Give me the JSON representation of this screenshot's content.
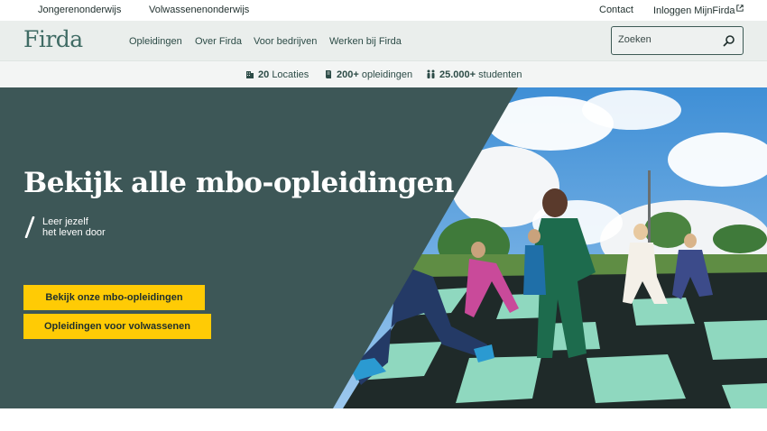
{
  "topbar": {
    "left_links": [
      "Jongerenonderwijs",
      "Volwassenenonderwijs"
    ],
    "contact": "Contact",
    "login": "Inloggen MijnFirda"
  },
  "nav": {
    "logo": "Firda",
    "links": [
      "Opleidingen",
      "Over Firda",
      "Voor bedrijven",
      "Werken bij Firda"
    ],
    "search_placeholder": "Zoeken"
  },
  "stats": [
    {
      "value": "20",
      "label": "Locaties",
      "icon": "building-icon"
    },
    {
      "value": "200+",
      "label": "opleidingen",
      "icon": "book-icon"
    },
    {
      "value": "25.000+",
      "label": "studenten",
      "icon": "people-icon"
    }
  ],
  "hero": {
    "title": "Bekijk alle mbo-opleidingen",
    "tagline_line1": "Leer jezelf",
    "tagline_line2": "het leven door",
    "cta_primary": "Bekijk onze mbo-opleidingen",
    "cta_secondary": "Opleidingen voor volwassenen"
  },
  "colors": {
    "brand_green": "#3f6b64",
    "hero_panel": "#3d5757",
    "cta_yellow": "#ffcb05",
    "nav_bg": "#eaeeec"
  }
}
